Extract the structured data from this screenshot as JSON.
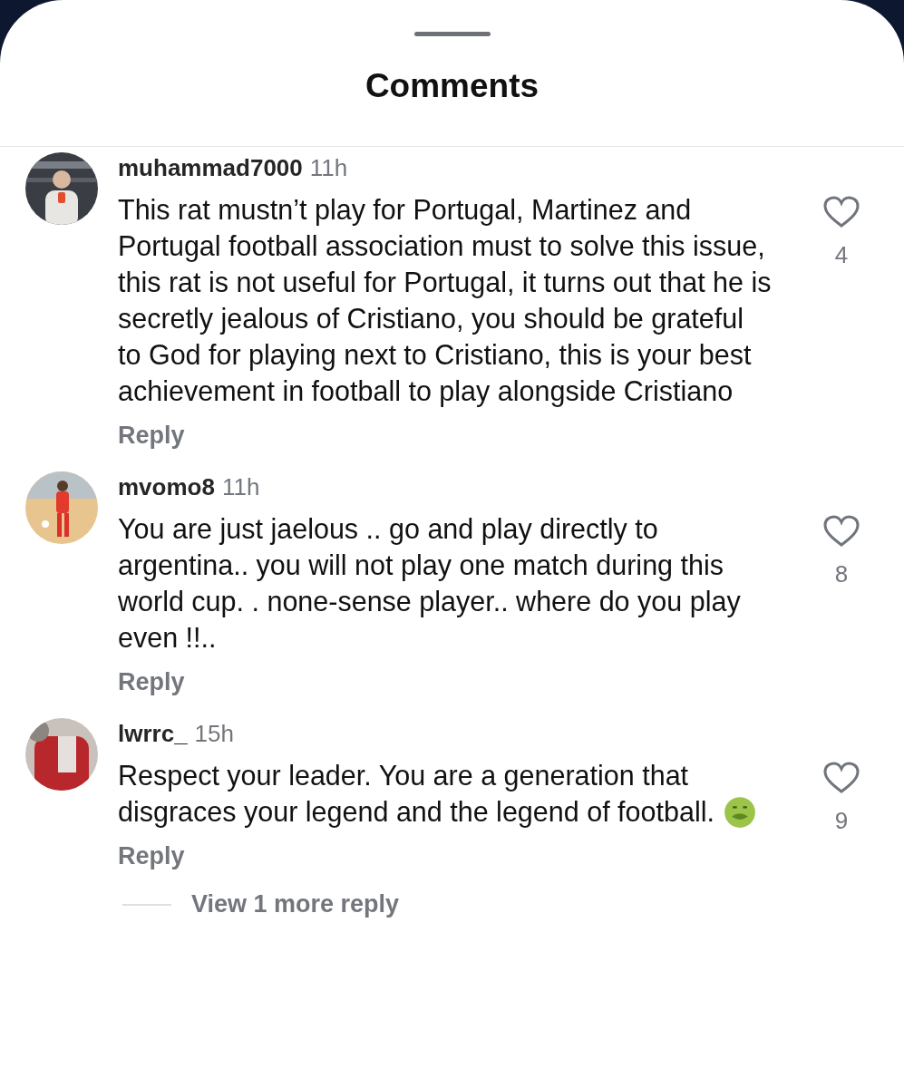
{
  "sheet": {
    "title": "Comments"
  },
  "comments": [
    {
      "username": "muhammad7000",
      "time": "11h",
      "text": "This rat mustn’t play for Portugal, Martinez and Portugal football association must to solve this issue, this rat  is not useful for Portugal, it turns out that he is secretly jealous of Cristiano, you should be grateful to God for playing next to Cristiano, this is your best achievement in football to play alongside Cristiano",
      "has_emoji": false,
      "reply_label": "Reply",
      "liked": false,
      "likes": "4"
    },
    {
      "username": "mvomo8",
      "time": "11h",
      "text": "You are just jaelous .. go and play directly to argentina.. you will not play one match during this world cup. . none-sense player.. where do you play even !!..",
      "has_emoji": false,
      "reply_label": "Reply",
      "liked": false,
      "likes": "8"
    },
    {
      "username": "lwrrc_",
      "time": "15h",
      "text": "Respect your leader. You are a generation that disgraces your legend and the legend of football.",
      "has_emoji": true,
      "reply_label": "Reply",
      "liked": false,
      "likes": "9",
      "more_replies": "View 1 more reply"
    }
  ]
}
